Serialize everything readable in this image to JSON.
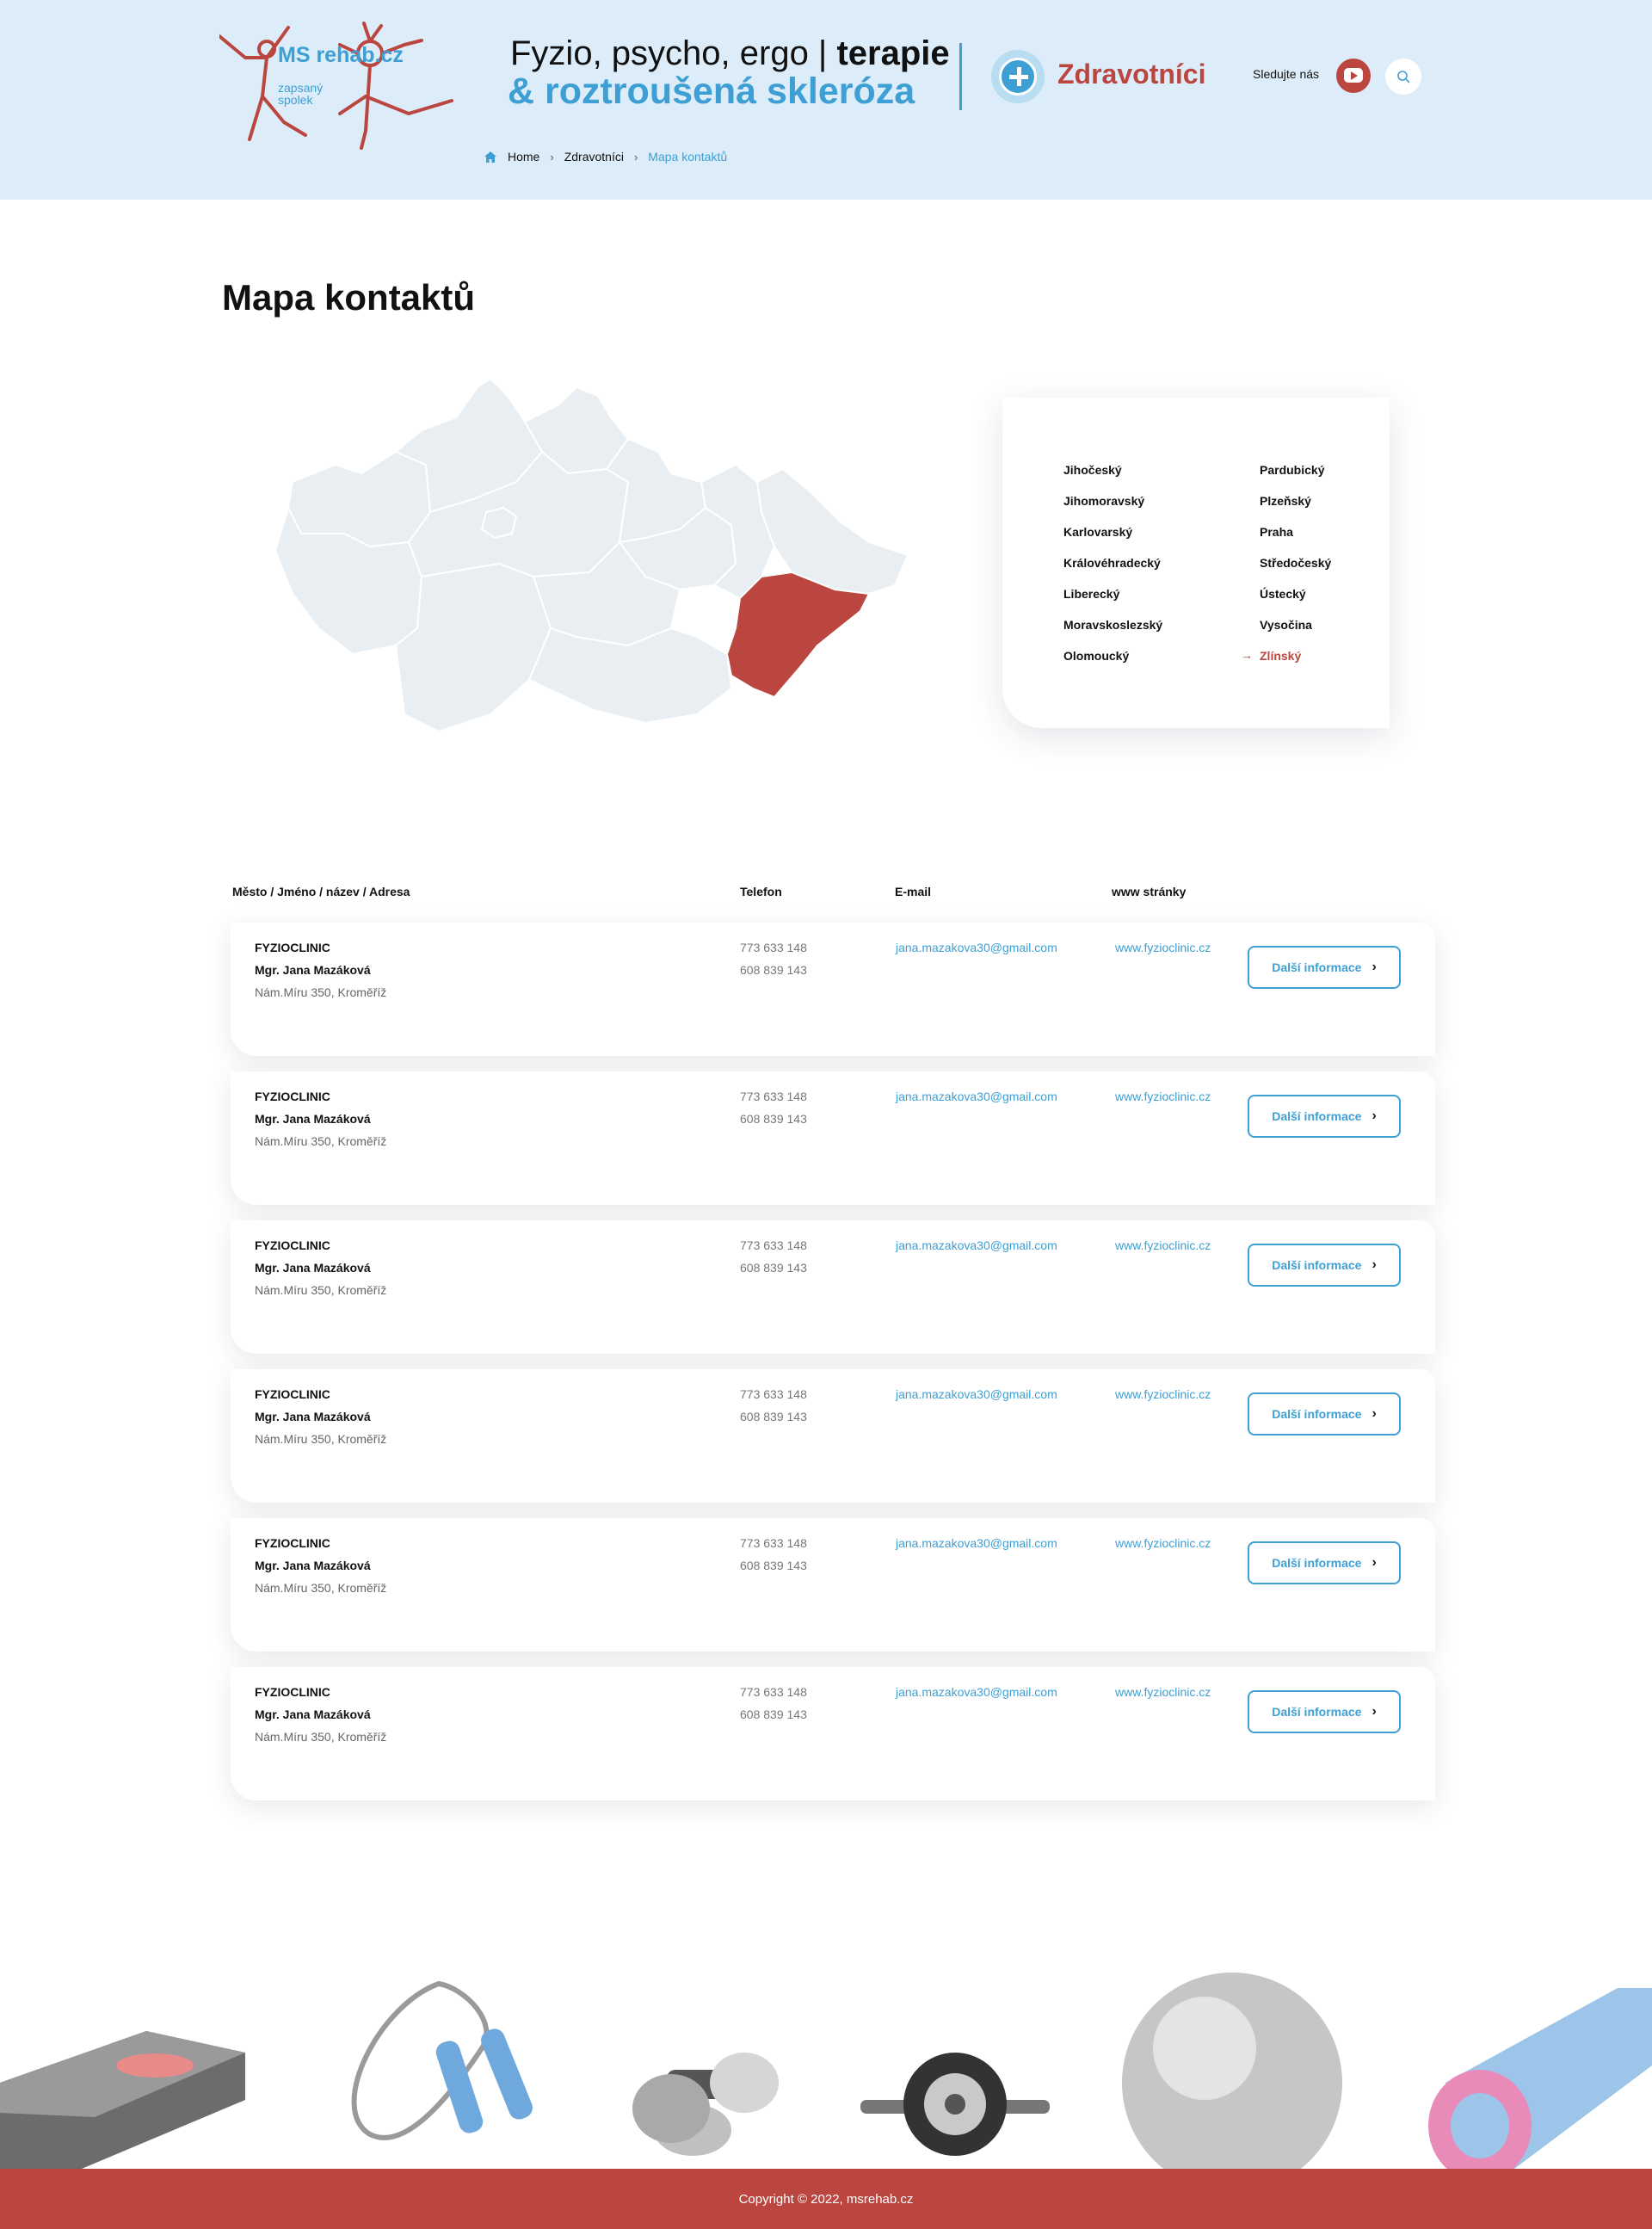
{
  "header": {
    "logo": {
      "main": "MS rehab.cz",
      "sub_1": "zapsaný",
      "sub_2": "spolek"
    },
    "tagline_1_normal": "Fyzio, psycho, ergo | ",
    "tagline_1_bold": "terapie",
    "tagline_2": "& roztroušená skleróza",
    "section": "Zdravotníci",
    "follow_label": "Sledujte nás",
    "colors": {
      "background": "#dcedf9",
      "accent_blue": "#3d9fd3",
      "accent_red": "#bb4640"
    }
  },
  "breadcrumb": [
    "Home",
    "Zdravotníci",
    "Mapa kontaktů"
  ],
  "page_title": "Mapa kontaktů",
  "regions": {
    "left": [
      "Jihočeský",
      "Jihomoravský",
      "Karlovarský",
      "Královéhradecký",
      "Liberecký",
      "Moravskoslezský",
      "Olomoucký"
    ],
    "right": [
      "Pardubický",
      "Plzeňský",
      "Praha",
      "Středočeský",
      "Ústecký",
      "Vysočina",
      "Zlínský"
    ],
    "selected": "Zlínský"
  },
  "table": {
    "headers": {
      "name": "Město / Jméno / název / Adresa",
      "phone": "Telefon",
      "email": "E-mail",
      "web": "www stránky"
    },
    "button_label": "Další informace",
    "rows": [
      {
        "company": "FYZIOCLINIC",
        "person": "Mgr. Jana Mazáková",
        "address": "Nám.Míru 350, Kroměříž",
        "phone_1": "773 633 148",
        "phone_2": "608 839 143",
        "email": "jana.mazakova30@gmail.com",
        "web": "www.fyzioclinic.cz"
      },
      {
        "company": "FYZIOCLINIC",
        "person": "Mgr. Jana Mazáková",
        "address": "Nám.Míru 350, Kroměříž",
        "phone_1": "773 633 148",
        "phone_2": "608 839 143",
        "email": "jana.mazakova30@gmail.com",
        "web": "www.fyzioclinic.cz"
      },
      {
        "company": "FYZIOCLINIC",
        "person": "Mgr. Jana Mazáková",
        "address": "Nám.Míru 350, Kroměříž",
        "phone_1": "773 633 148",
        "phone_2": "608 839 143",
        "email": "jana.mazakova30@gmail.com",
        "web": "www.fyzioclinic.cz"
      },
      {
        "company": "FYZIOCLINIC",
        "person": "Mgr. Jana Mazáková",
        "address": "Nám.Míru 350, Kroměříž",
        "phone_1": "773 633 148",
        "phone_2": "608 839 143",
        "email": "jana.mazakova30@gmail.com",
        "web": "www.fyzioclinic.cz"
      },
      {
        "company": "FYZIOCLINIC",
        "person": "Mgr. Jana Mazáková",
        "address": "Nám.Míru 350, Kroměříž",
        "phone_1": "773 633 148",
        "phone_2": "608 839 143",
        "email": "jana.mazakova30@gmail.com",
        "web": "www.fyzioclinic.cz"
      },
      {
        "company": "FYZIOCLINIC",
        "person": "Mgr. Jana Mazáková",
        "address": "Nám.Míru 350, Kroměříž",
        "phone_1": "773 633 148",
        "phone_2": "608 839 143",
        "email": "jana.mazakova30@gmail.com",
        "web": "www.fyzioclinic.cz"
      }
    ]
  },
  "equipment_icons": [
    "step-platform-icon",
    "jump-rope-icon",
    "dumbbell-icon",
    "ab-wheel-icon",
    "fitness-ball-icon",
    "yoga-mat-icon"
  ],
  "footer": {
    "copyright": "Copyright © 2022, msrehab.cz"
  }
}
